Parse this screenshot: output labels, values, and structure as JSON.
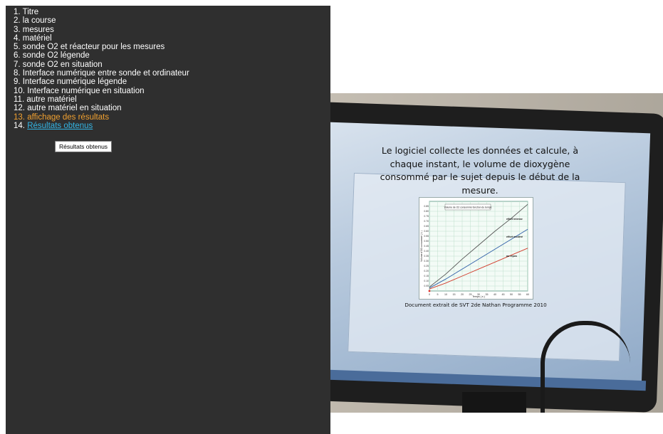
{
  "menu": {
    "items": [
      {
        "num": "1.",
        "label": "Titre"
      },
      {
        "num": "2.",
        "label": "la course"
      },
      {
        "num": "3.",
        "label": "mesures"
      },
      {
        "num": "4.",
        "label": "matériel"
      },
      {
        "num": "5.",
        "label": "sonde O2 et réacteur pour les mesures"
      },
      {
        "num": "6.",
        "label": "sonde O2 légende"
      },
      {
        "num": "7.",
        "label": "sonde O2 en situation"
      },
      {
        "num": "8.",
        "label": "Interface numérique entre sonde et ordinateur"
      },
      {
        "num": "9.",
        "label": "Interface numérique légende"
      },
      {
        "num": "10.",
        "label": "Interface numérique en situation"
      },
      {
        "num": "11.",
        "label": "autre matériel"
      },
      {
        "num": "12.",
        "label": "autre matériel en situation"
      },
      {
        "num": "13.",
        "label": "affichage des résultats"
      },
      {
        "num": "14.",
        "label": "Résultats obtenus"
      }
    ],
    "active_index": 13,
    "hovered_index": 14
  },
  "tooltip": {
    "text": "Résultats obtenus"
  },
  "slide": {
    "caption": "Le logiciel collecte les données et calcule, à chaque instant, le volume de dioxygène consommé par le sujet depuis le début de la mesure.",
    "source": "Document extrait de SVT 2de Nathan Programme 2010"
  },
  "colors": {
    "panel_bg": "#2f2f2f",
    "active": "#f0a030",
    "link": "#33b5e5"
  },
  "chart_data": {
    "type": "line",
    "title": "Volume de O2 consommé fonction du temps",
    "xlabel": "Temps ( s )",
    "ylabel": "Volume d'O2 consommé ( L )",
    "xlim": [
      0,
      60
    ],
    "ylim": [
      0,
      0.9
    ],
    "x_ticks": [
      "0",
      "5",
      "10",
      "15",
      "20",
      "25",
      "30",
      "35",
      "40",
      "45",
      "50",
      "55",
      "60"
    ],
    "y_ticks": [
      "0.05",
      "0.10",
      "0.15",
      "0.20",
      "0.25",
      "0.30",
      "0.35",
      "0.40",
      "0.45",
      "0.50",
      "0.55",
      "0.60",
      "0.65",
      "0.70",
      "0.75",
      "0.80",
      "0.85"
    ],
    "grid": true,
    "series": [
      {
        "name": "effort intense",
        "color": "#555555",
        "x": [
          0,
          10,
          20,
          30,
          40,
          50,
          60
        ],
        "y": [
          0.04,
          0.17,
          0.32,
          0.46,
          0.6,
          0.73,
          0.87
        ]
      },
      {
        "name": "effort modéré",
        "color": "#2f5fa8",
        "x": [
          0,
          10,
          20,
          30,
          40,
          50,
          60
        ],
        "y": [
          0.03,
          0.12,
          0.22,
          0.32,
          0.42,
          0.52,
          0.62
        ]
      },
      {
        "name": "au repos",
        "color": "#d23a2a",
        "x": [
          0,
          10,
          20,
          30,
          40,
          50,
          60
        ],
        "y": [
          0.02,
          0.08,
          0.15,
          0.22,
          0.29,
          0.36,
          0.43
        ]
      }
    ]
  }
}
